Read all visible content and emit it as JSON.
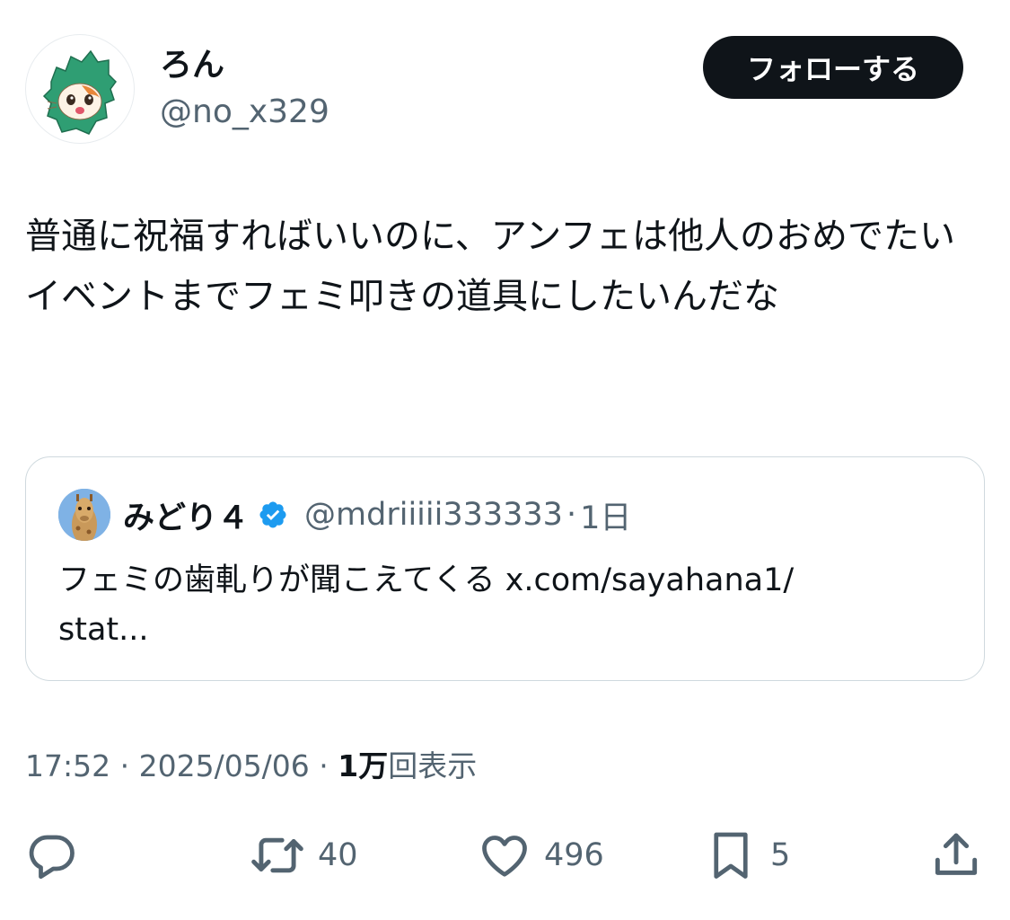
{
  "author": {
    "display_name": "ろん",
    "handle": "@no_x329"
  },
  "follow_label": "フォローする",
  "tweet_text": "普通に祝福すればいいのに、アンフェは他人のおめでたいイベントまでフェミ叩きの道具にしたいんだな",
  "quote": {
    "display_name": "みどり４",
    "handle": "@mdriiiii333333",
    "separator": "·",
    "time": "1日",
    "text": "フェミの歯軋りが聞こえてくる x.com/sayahana1/\nstat..."
  },
  "meta": {
    "time": "17:52",
    "sep1": " · ",
    "date": "2025/05/06",
    "sep2": " · ",
    "views_count": "1万",
    "views_label": "回表示"
  },
  "actions": {
    "reply_count": "",
    "retweet_count": "40",
    "like_count": "496",
    "bookmark_count": "5"
  },
  "icons": {
    "reply": "speech-bubble-icon",
    "retweet": "retweet-arrows-icon",
    "like": "heart-icon",
    "bookmark": "bookmark-icon",
    "share": "share-upload-icon",
    "verified": "verified-badge-icon"
  },
  "colors": {
    "text_primary": "#0f1419",
    "text_secondary": "#536471",
    "verified_blue": "#1d9bf0",
    "follow_bg": "#0f1419",
    "border": "#cfd9de"
  }
}
